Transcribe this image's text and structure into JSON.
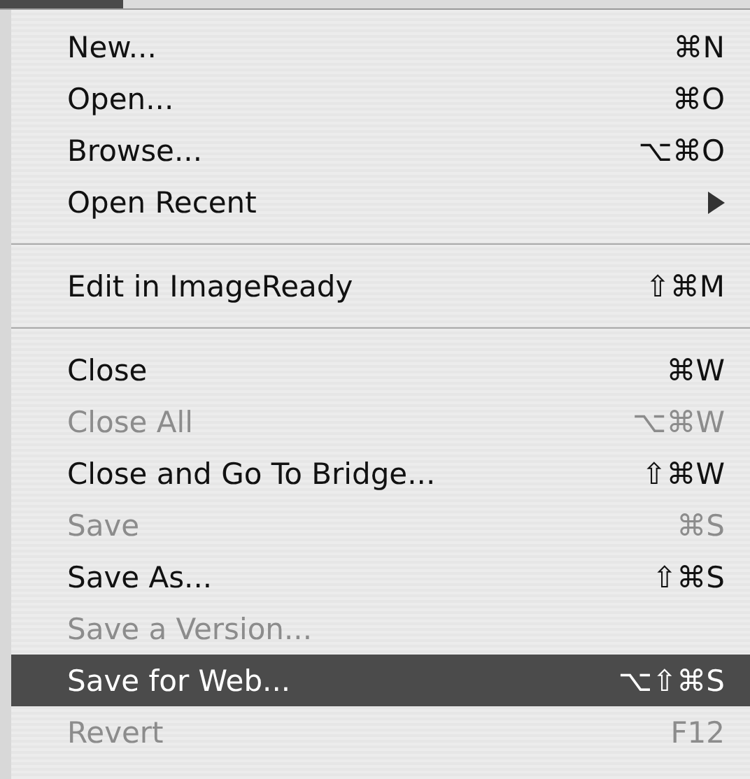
{
  "menu": {
    "items": [
      {
        "kind": "item",
        "label": "New...",
        "shortcut": "⌘N",
        "disabled": false,
        "selected": false,
        "submenu": false
      },
      {
        "kind": "item",
        "label": "Open...",
        "shortcut": "⌘O",
        "disabled": false,
        "selected": false,
        "submenu": false
      },
      {
        "kind": "item",
        "label": "Browse...",
        "shortcut": "⌥⌘O",
        "disabled": false,
        "selected": false,
        "submenu": false
      },
      {
        "kind": "item",
        "label": "Open Recent",
        "disabled": false,
        "selected": false,
        "submenu": true
      },
      {
        "kind": "separator"
      },
      {
        "kind": "item",
        "label": "Edit in ImageReady",
        "shortcut": "⇧⌘M",
        "disabled": false,
        "selected": false,
        "submenu": false
      },
      {
        "kind": "separator"
      },
      {
        "kind": "item",
        "label": "Close",
        "shortcut": "⌘W",
        "disabled": false,
        "selected": false,
        "submenu": false
      },
      {
        "kind": "item",
        "label": "Close All",
        "shortcut": "⌥⌘W",
        "disabled": true,
        "selected": false,
        "submenu": false
      },
      {
        "kind": "item",
        "label": "Close and Go To Bridge...",
        "shortcut": "⇧⌘W",
        "disabled": false,
        "selected": false,
        "submenu": false
      },
      {
        "kind": "item",
        "label": "Save",
        "shortcut": "⌘S",
        "disabled": true,
        "selected": false,
        "submenu": false
      },
      {
        "kind": "item",
        "label": "Save As...",
        "shortcut": "⇧⌘S",
        "disabled": false,
        "selected": false,
        "submenu": false
      },
      {
        "kind": "item",
        "label": "Save a Version...",
        "disabled": true,
        "selected": false,
        "submenu": false
      },
      {
        "kind": "item",
        "label": "Save for Web...",
        "shortcut": "⌥⇧⌘S",
        "disabled": false,
        "selected": true,
        "submenu": false
      },
      {
        "kind": "item",
        "label": "Revert",
        "shortcut": "F12",
        "disabled": true,
        "selected": false,
        "submenu": false
      }
    ]
  }
}
